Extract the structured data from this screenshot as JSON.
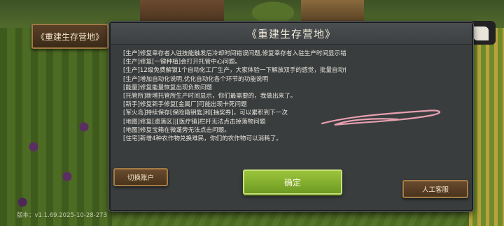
{
  "side_badge": {
    "label": "《重建生存营地》"
  },
  "dialog": {
    "title": "《重建生存营地》",
    "changelog": [
      "[生产]修复幸存者入驻技能触发后冷却时间错误问题,修复幸存者入驻生产时间显示错误。",
      "[生产]修复[一键种植]会打开托管中心问题。",
      "[生产]12级免费解锁1个自动化工厂生产，大家体验一下解放双手的感觉，批量自动化是金卡特权。",
      "[生产]增加自动化说明,优化自动化各个环节的功能说明",
      "[能量]修复能量恢复出现负数问题",
      "[托管所]新增托管所生产时间显示，你们最需要的，我做出来了。",
      "[新手]修复新手修复[金属厂]可能出现卡死问题",
      "[军火岛]持续保存[保险箱钥匙]和[抽奖券]，可以累积到下一次",
      "[地图]修复[遗落区]|[医疗镇]栏杆无法点击掉落物问题",
      "[地图]修复宝箱在微蓬旁无法点击问题。",
      "[住宅]新增4种农作物兑换难民，你们的农作物可以消耗了。"
    ],
    "confirm_label": "确定"
  },
  "buttons": {
    "switch_account": "切换账户",
    "customer_service": "人工客服"
  },
  "version_text": "版本：v1.1.69.2025-10-28-273",
  "colors": {
    "dialog_bg": "#3a3d3e",
    "confirm_green": "#8ab833",
    "wood_brown": "#5a4028",
    "scribble_pink": "#e8a0b0"
  },
  "icons": {
    "scribble": "hand-drawn-annotation-stroke"
  }
}
